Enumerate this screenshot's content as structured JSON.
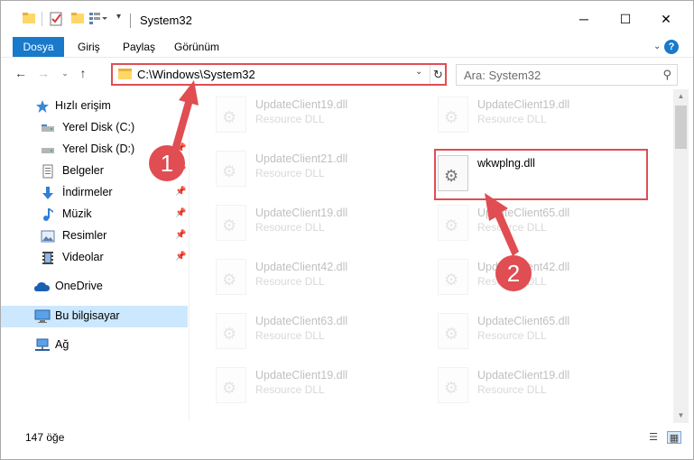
{
  "window": {
    "title": "System32",
    "controls": {
      "minimize": "─",
      "maximize": "☐",
      "close": "✕"
    }
  },
  "ribbon": {
    "tabs": [
      "Dosya",
      "Giriş",
      "Paylaş",
      "Görünüm"
    ],
    "help": "?"
  },
  "addressbar": {
    "path": "C:\\Windows\\System32",
    "search_placeholder": "Ara: System32"
  },
  "nav": {
    "items": [
      {
        "label": "Hızlı erişim",
        "icon": "star-icon",
        "pinned": false
      },
      {
        "label": "Yerel Disk (C:)",
        "icon": "drive-icon",
        "pinned": false
      },
      {
        "label": "Yerel Disk (D:)",
        "icon": "drive-icon",
        "pinned": false
      },
      {
        "label": "Belgeler",
        "icon": "documents-icon",
        "pinned": true
      },
      {
        "label": "İndirmeler",
        "icon": "download-icon",
        "pinned": true
      },
      {
        "label": "Müzik",
        "icon": "music-icon",
        "pinned": true
      },
      {
        "label": "Resimler",
        "icon": "pictures-icon",
        "pinned": true
      },
      {
        "label": "Videolar",
        "icon": "videos-icon",
        "pinned": true
      },
      {
        "label": "OneDrive",
        "icon": "cloud-icon",
        "pinned": false
      },
      {
        "label": "Bu bilgisayar",
        "icon": "computer-icon",
        "pinned": false,
        "selected": true
      },
      {
        "label": "Ağ",
        "icon": "network-icon",
        "pinned": false
      }
    ]
  },
  "files": {
    "left": [
      {
        "name": "UpdateClient19.dll",
        "type": "Resource DLL"
      },
      {
        "name": "UpdateClient21.dll",
        "type": "Resource DLL"
      },
      {
        "name": "UpdateClient19.dll",
        "type": "Resource DLL"
      },
      {
        "name": "UpdateClient42.dll",
        "type": "Resource DLL"
      },
      {
        "name": "UpdateClient63.dll",
        "type": "Resource DLL"
      },
      {
        "name": "UpdateClient19.dll",
        "type": "Resource DLL"
      }
    ],
    "right": [
      {
        "name": "UpdateClient19.dll",
        "type": "Resource DLL"
      },
      {
        "name": "wkwplng.dll",
        "type": ""
      },
      {
        "name": "UpdateClient65.dll",
        "type": "Resource DLL"
      },
      {
        "name": "UpdateClient42.dll",
        "type": "Resource DLL"
      },
      {
        "name": "UpdateClient65.dll",
        "type": "Resource DLL"
      },
      {
        "name": "UpdateClient19.dll",
        "type": "Resource DLL"
      }
    ]
  },
  "annotations": {
    "step1": "1",
    "step2": "2",
    "color": "#e04d52"
  },
  "status": {
    "count": "147 öğe"
  }
}
